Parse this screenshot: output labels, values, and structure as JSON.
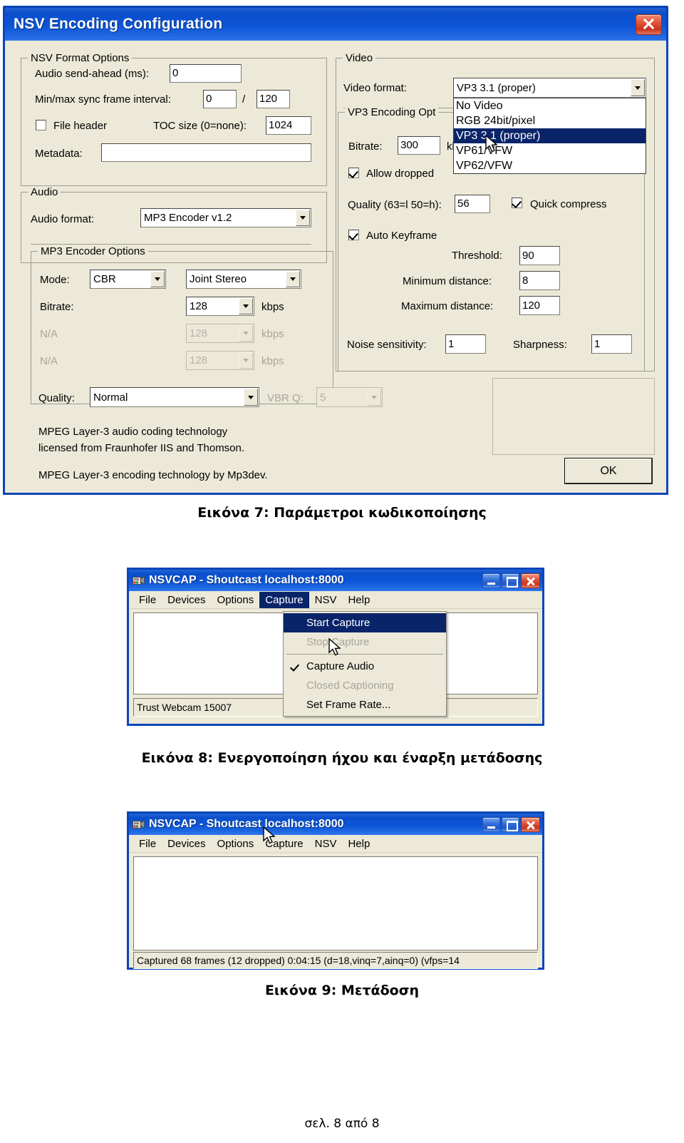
{
  "figure7": {
    "window_title": "NSV Encoding Configuration",
    "close_icon": "close-icon",
    "nsv_format_options": {
      "group_title": "NSV Format Options",
      "audio_sendahead_label": "Audio send-ahead (ms):",
      "audio_sendahead_value": "0",
      "sync_frame_label": "Min/max sync frame interval:",
      "sync_min_value": "0",
      "sync_separator": "/",
      "sync_max_value": "120",
      "file_header_label": "File header",
      "file_header_checked": false,
      "toc_size_label": "TOC size (0=none):",
      "toc_size_value": "1024",
      "metadata_label": "Metadata:",
      "metadata_value": ""
    },
    "audio": {
      "group_title": "Audio",
      "audio_format_label": "Audio format:",
      "audio_format_value": "MP3 Encoder v1.2"
    },
    "mp3_encoder_options": {
      "group_title": "MP3 Encoder Options",
      "mode_label": "Mode:",
      "mode_value": "CBR",
      "channel_mode_value": "Joint Stereo",
      "bitrate_label": "Bitrate:",
      "bitrate_value": "128",
      "bitrate_unit": "kbps",
      "na1_label": "N/A",
      "na1_value": "128",
      "na1_unit": "kbps",
      "na2_label": "N/A",
      "na2_value": "128",
      "na2_unit": "kbps",
      "quality_label": "Quality:",
      "quality_value": "Normal",
      "vbrq_label": "VBR Q:",
      "vbrq_value": "5",
      "legal_line1": "MPEG Layer-3 audio coding technology",
      "legal_line2": "licensed from Fraunhofer IIS and Thomson.",
      "legal_line3": "MPEG Layer-3 encoding technology by Mp3dev."
    },
    "video": {
      "group_title": "Video",
      "video_format_label": "Video format:",
      "video_format_value": "VP3 3.1 (proper)",
      "dropdown_open": true,
      "dropdown_options": [
        "No Video",
        "RGB 24bit/pixel",
        "VP3 3.1 (proper)",
        "VP61/VFW",
        "VP62/VFW"
      ],
      "dropdown_selected_index": 2
    },
    "vp3_encoding_options": {
      "group_title": "VP3 Encoding Opt",
      "bitrate_label": "Bitrate:",
      "bitrate_value": "300",
      "bitrate_unit": "kb",
      "allow_dropped_label": "Allow dropped",
      "allow_dropped_checked": true,
      "quality_label": "Quality (63=l 50=h):",
      "quality_value": "56",
      "quick_compress_label": "Quick compress",
      "quick_compress_checked": true,
      "auto_keyframe_label": "Auto Keyframe",
      "auto_keyframe_checked": true,
      "threshold_label": "Threshold:",
      "threshold_value": "90",
      "min_distance_label": "Minimum distance:",
      "min_distance_value": "8",
      "max_distance_label": "Maximum distance:",
      "max_distance_value": "120",
      "noise_sensitivity_label": "Noise sensitivity:",
      "noise_sensitivity_value": "1",
      "sharpness_label": "Sharpness:",
      "sharpness_value": "1"
    },
    "ok_button": "OK",
    "caption": "Εικόνα 7: Παράμετροι κωδικοποίησης"
  },
  "figure8": {
    "window_title": "NSVCAP - Shoutcast localhost:8000",
    "minimize_icon": "minimize-icon",
    "maximize_icon": "maximize-icon",
    "close_icon": "close-icon",
    "app_icon": "camera-icon",
    "menus": [
      "File",
      "Devices",
      "Options",
      "Capture",
      "NSV",
      "Help"
    ],
    "active_menu": "Capture",
    "capture_menu": [
      {
        "label": "Start Capture",
        "state": "selected",
        "check": false
      },
      {
        "label": "Stop Capture",
        "state": "disabled",
        "check": false
      },
      {
        "label": "__separator__",
        "state": "separator",
        "check": false
      },
      {
        "label": "Capture Audio",
        "state": "normal",
        "check": true
      },
      {
        "label": "Closed Captioning",
        "state": "disabled",
        "check": false
      },
      {
        "label": "Set Frame Rate...",
        "state": "normal",
        "check": false
      }
    ],
    "statusbar": "Trust Webcam 15007",
    "caption": "Εικόνα 8: Ενεργοποίηση ήχου και έναρξη μετάδοσης"
  },
  "figure9": {
    "window_title": "NSVCAP - Shoutcast localhost:8000",
    "minimize_icon": "minimize-icon",
    "maximize_icon": "maximize-icon",
    "close_icon": "close-icon",
    "app_icon": "camera-icon",
    "menus": [
      "File",
      "Devices",
      "Options",
      "Capture",
      "NSV",
      "Help"
    ],
    "statusbar": "Captured 68 frames (12 dropped) 0:04:15 (d=18,vinq=7,ainq=0) (vfps=14",
    "caption": "Εικόνα 9: Μετάδοση"
  },
  "page_footer": "σελ. 8 από 8",
  "colors": {
    "title_blue": "#0a4ecb",
    "window_border": "#0a46b8",
    "dialog_face": "#ece9d8",
    "selection_blue": "#0a246a",
    "dropdown_selection": "#1259c9",
    "close_red": "#c8341c"
  }
}
